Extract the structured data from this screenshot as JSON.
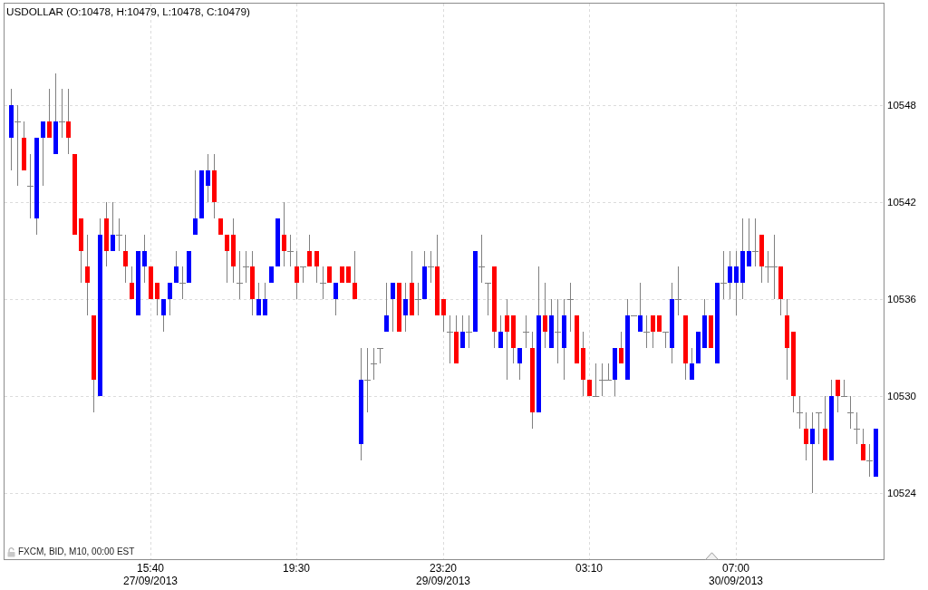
{
  "chart": {
    "title": "USDOLLAR (O:10478, H:10479, L:10478, C:10479)",
    "chart_data": {
      "type": "candlestick",
      "ylim": [
        10519.9,
        10554.3
      ],
      "yticks": [
        10548,
        10542,
        10536,
        10530,
        10524
      ],
      "grid": true,
      "categories": [
        null,
        null,
        null,
        null,
        null,
        null,
        null,
        null,
        null,
        null,
        null,
        null,
        null,
        null,
        null,
        null,
        null,
        null,
        null,
        null,
        null,
        null,
        "15:40\n27/09/2013",
        null,
        null,
        null,
        null,
        null,
        null,
        null,
        null,
        null,
        null,
        null,
        null,
        null,
        null,
        null,
        null,
        null,
        null,
        null,
        null,
        null,
        null,
        "19:30",
        null,
        null,
        null,
        null,
        null,
        null,
        null,
        null,
        null,
        null,
        null,
        null,
        null,
        null,
        null,
        null,
        null,
        null,
        null,
        null,
        null,
        null,
        "23:20\n29/09/2013",
        null,
        null,
        null,
        null,
        null,
        null,
        null,
        null,
        null,
        null,
        null,
        null,
        null,
        null,
        null,
        null,
        null,
        null,
        null,
        null,
        null,
        null,
        "03:10",
        null,
        null,
        null,
        null,
        null,
        null,
        null,
        null,
        null,
        null,
        null,
        null,
        null,
        null,
        null,
        null,
        null,
        null,
        null,
        null,
        null,
        null,
        "07:00\n30/09/2013",
        null,
        null,
        null,
        null,
        null,
        null,
        null,
        null,
        null,
        null,
        null,
        null,
        null,
        null,
        null,
        null,
        null,
        null,
        null,
        null,
        null,
        null
      ],
      "ohlc": [
        [
          10546,
          10549,
          10544,
          10548
        ],
        [
          10547,
          10548,
          10543,
          10547
        ],
        [
          10546,
          10547,
          10544,
          10544
        ],
        [
          10543,
          10545,
          10541,
          10543
        ],
        [
          10541,
          10546,
          10540,
          10546
        ],
        [
          10546,
          10547,
          10543,
          10547
        ],
        [
          10547,
          10549,
          10546,
          10546
        ],
        [
          10545,
          10550,
          10545,
          10547
        ],
        [
          10547,
          10549,
          10546,
          10547
        ],
        [
          10547,
          10549,
          10545,
          10546
        ],
        [
          10545,
          10545,
          10540,
          10540
        ],
        [
          10541,
          10541,
          10537,
          10539
        ],
        [
          10538,
          10540,
          10535,
          10537
        ],
        [
          10535,
          10535,
          10529,
          10531
        ],
        [
          10530,
          10541,
          10530,
          10540
        ],
        [
          10541,
          10542,
          10538,
          10539
        ],
        [
          10539,
          10542,
          10539,
          10540
        ],
        [
          10540,
          10541,
          10539,
          10540
        ],
        [
          10539,
          10540,
          10537,
          10538
        ],
        [
          10537,
          10538,
          10536,
          10536
        ],
        [
          10535,
          10539,
          10535,
          10539
        ],
        [
          10538,
          10540,
          10537,
          10539
        ],
        [
          10538,
          10538,
          10536,
          10536
        ],
        [
          10537,
          10537,
          10535,
          10536
        ],
        [
          10535,
          10536,
          10534,
          10536
        ],
        [
          10536,
          10537,
          10535,
          10537
        ],
        [
          10537,
          10539,
          10537,
          10538
        ],
        [
          10537,
          10538,
          10536,
          10537
        ],
        [
          10537,
          10539,
          10537,
          10539
        ],
        [
          10540,
          10544,
          10540,
          10541
        ],
        [
          10541,
          10544,
          10541,
          10544
        ],
        [
          10543,
          10545,
          10542,
          10544
        ],
        [
          10544,
          10545,
          10541,
          10542
        ],
        [
          10541,
          10541,
          10540,
          10540
        ],
        [
          10540,
          10540,
          10537,
          10539
        ],
        [
          10540,
          10541,
          10537,
          10538
        ],
        [
          10537,
          10539,
          10536,
          10537
        ],
        [
          10538,
          10539,
          10537,
          10538
        ],
        [
          10538,
          10539,
          10535,
          10536
        ],
        [
          10535,
          10537,
          10535,
          10536
        ],
        [
          10535,
          10537,
          10535,
          10536
        ],
        [
          10537,
          10538,
          10537,
          10538
        ],
        [
          10538,
          10541,
          10538,
          10541
        ],
        [
          10540,
          10542,
          10538,
          10539
        ],
        [
          10539,
          10540,
          10538,
          10539
        ],
        [
          10538,
          10539,
          10536,
          10537
        ],
        [
          10538,
          10538,
          10537,
          10538
        ],
        [
          10539,
          10540,
          10538,
          10538
        ],
        [
          10539,
          10539,
          10537,
          10538
        ],
        [
          10537,
          10538,
          10536,
          10537
        ],
        [
          10538,
          10538,
          10537,
          10537
        ],
        [
          10536,
          10537,
          10535,
          10537
        ],
        [
          10538,
          10538,
          10537,
          10537
        ],
        [
          10538,
          10538,
          10537,
          10537
        ],
        [
          10537,
          10539,
          10536,
          10536
        ],
        [
          10527,
          10533,
          10526,
          10531
        ],
        [
          10531,
          10533,
          10529,
          10531
        ],
        [
          10532,
          10533,
          10531,
          10532
        ],
        [
          10533,
          10533,
          10532,
          10533
        ],
        [
          10534,
          10537,
          10534,
          10535
        ],
        [
          10536,
          10537,
          10534,
          10537
        ],
        [
          10537,
          10537,
          10534,
          10534
        ],
        [
          10535,
          10537,
          10534,
          10536
        ],
        [
          10537,
          10539,
          10535,
          10535
        ],
        [
          10536,
          10537,
          10535,
          10536
        ],
        [
          10536,
          10539,
          10536,
          10538
        ],
        [
          10538,
          10539,
          10537,
          10538
        ],
        [
          10538,
          10540,
          10535,
          10535
        ],
        [
          10536,
          10536,
          10534,
          10535
        ],
        [
          10534,
          10535,
          10532,
          10534
        ],
        [
          10534,
          10535,
          10532,
          10532
        ],
        [
          10533,
          10535,
          10533,
          10534
        ],
        [
          10534,
          10535,
          10533,
          10534
        ],
        [
          10534,
          10539,
          10534,
          10539
        ],
        [
          10538,
          10540,
          10537,
          10538
        ],
        [
          10537,
          10537,
          10535,
          10537
        ],
        [
          10538,
          10538,
          10533,
          10534
        ],
        [
          10533,
          10535,
          10533,
          10534
        ],
        [
          10535,
          10536,
          10531,
          10534
        ],
        [
          10535,
          10535,
          10532,
          10533
        ],
        [
          10532,
          10533,
          10531,
          10533
        ],
        [
          10534,
          10535,
          10533,
          10534
        ],
        [
          10533,
          10534,
          10528,
          10529
        ],
        [
          10529,
          10538,
          10529,
          10535
        ],
        [
          10535,
          10537,
          10533,
          10534
        ],
        [
          10533,
          10536,
          10533,
          10535
        ],
        [
          10534,
          10536,
          10532,
          10534
        ],
        [
          10533,
          10536,
          10531,
          10535
        ],
        [
          10536,
          10537,
          10534,
          10536
        ],
        [
          10535,
          10535,
          10532,
          10532
        ],
        [
          10533,
          10534,
          10530,
          10531
        ],
        [
          10531,
          10531,
          10530,
          10530
        ],
        [
          10530,
          10532,
          10530,
          10530
        ],
        [
          10531,
          10532,
          10530,
          10531
        ],
        [
          10531,
          10532,
          10531,
          10531
        ],
        [
          10531,
          10533,
          10530,
          10533
        ],
        [
          10533,
          10534,
          10532,
          10532
        ],
        [
          10531,
          10536,
          10531,
          10535
        ],
        [
          10535,
          10535,
          10535,
          10535
        ],
        [
          10534,
          10537,
          10534,
          10535
        ],
        [
          10534,
          10535,
          10533,
          10534
        ],
        [
          10535,
          10535,
          10533,
          10534
        ],
        [
          10535,
          10535,
          10534,
          10534
        ],
        [
          10534,
          10534,
          10533,
          10534
        ],
        [
          10533,
          10537,
          10532,
          10536
        ],
        [
          10536,
          10538,
          10535,
          10536
        ],
        [
          10535,
          10535,
          10531,
          10532
        ],
        [
          10531,
          10533,
          10531,
          10532
        ],
        [
          10532,
          10534,
          10532,
          10534
        ],
        [
          10533,
          10536,
          10533,
          10535
        ],
        [
          10535,
          10535,
          10533,
          10533
        ],
        [
          10532,
          10537,
          10532,
          10537
        ],
        [
          10537,
          10539,
          10536,
          10537
        ],
        [
          10537,
          10539,
          10536,
          10538
        ],
        [
          10537,
          10539,
          10535,
          10538
        ],
        [
          10537,
          10541,
          10536,
          10539
        ],
        [
          10538,
          10541,
          10538,
          10539
        ],
        [
          10539,
          10541,
          10538,
          10539
        ],
        [
          10540,
          10540,
          10537,
          10538
        ],
        [
          10538,
          10539,
          10537,
          10538
        ],
        [
          10538,
          10540,
          10536,
          10538
        ],
        [
          10538,
          10538,
          10535,
          10536
        ],
        [
          10535,
          10536,
          10531,
          10533
        ],
        [
          10534,
          10534,
          10529,
          10530
        ],
        [
          10529,
          10530,
          10528,
          10529
        ],
        [
          10528,
          10529,
          10526,
          10527
        ],
        [
          10527,
          10529,
          10524,
          10528
        ],
        [
          10529,
          10529,
          10527,
          10529
        ],
        [
          10528,
          10530,
          10526,
          10526
        ],
        [
          10526,
          10531,
          10526,
          10530
        ],
        [
          10531,
          10531,
          10529,
          10530
        ],
        [
          10530,
          10531,
          10530,
          10530
        ],
        [
          10529,
          10530,
          10528,
          10529
        ],
        [
          10528,
          10529,
          10527,
          10528
        ],
        [
          10527,
          10528,
          10526,
          10526
        ],
        [
          10526,
          10527,
          10525,
          10526
        ],
        [
          10525,
          10528,
          10525,
          10528
        ]
      ]
    },
    "footer": "FXCM, BID, M10, 00:00 EST"
  }
}
